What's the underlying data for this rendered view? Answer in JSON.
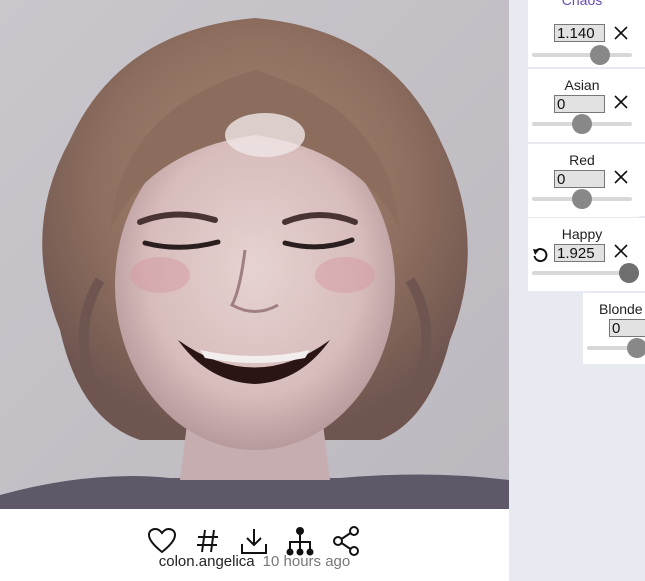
{
  "image": {
    "alt_icon": "generated-face-portrait"
  },
  "actions": [
    {
      "name": "like-button",
      "icon": "heart-icon"
    },
    {
      "name": "tag-button",
      "icon": "hash-icon"
    },
    {
      "name": "download-button",
      "icon": "download-icon"
    },
    {
      "name": "lineage-button",
      "icon": "family-tree-icon"
    },
    {
      "name": "share-button",
      "icon": "share-icon"
    }
  ],
  "meta": {
    "username": "colon.angelica",
    "timestamp": "10 hours ago"
  },
  "genes": [
    {
      "label": "Chaos",
      "value": "1.140",
      "level": 0.68,
      "accent": true
    },
    {
      "label": "Asian",
      "value": "0",
      "level": 0.5
    },
    {
      "label": "Red",
      "value": "0",
      "level": 0.5
    },
    {
      "label": "Happy",
      "value": "1.925",
      "level": 0.97
    },
    {
      "label": "Blonde",
      "value": "0",
      "level": 0.5
    }
  ],
  "colors": {
    "accent": "#6a4bb5",
    "thumb": "#888888",
    "panel_bg": "#e7eaf0"
  }
}
